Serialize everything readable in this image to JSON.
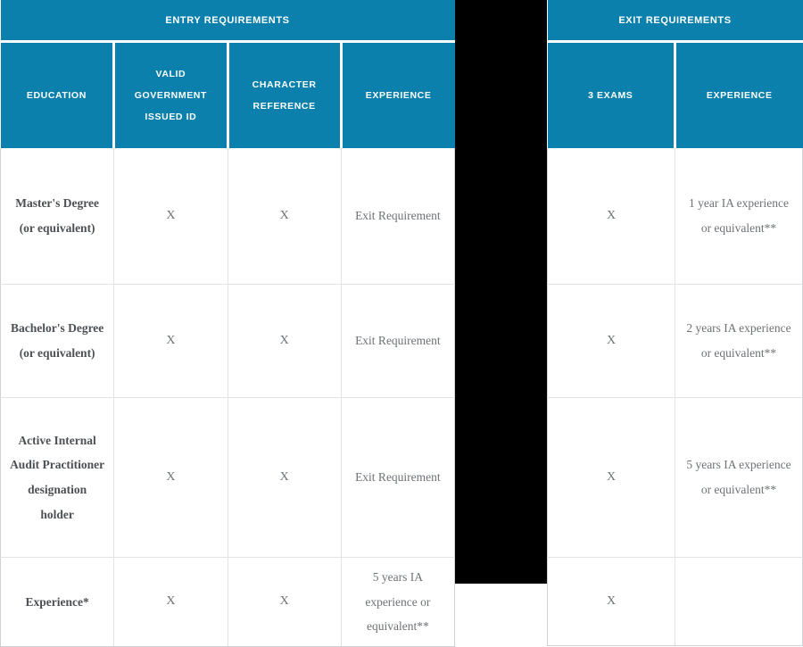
{
  "table": {
    "groups": [
      {
        "id": "entry",
        "label": "ENTRY REQUIREMENTS",
        "colspan": 4
      },
      {
        "id": "exit",
        "label": "EXIT REQUIREMENTS",
        "colspan": 2
      }
    ],
    "columns": {
      "entry": [
        {
          "id": "education",
          "label": "EDUCATION"
        },
        {
          "id": "valid_id",
          "label": "VALID\nGOVERNMENT\nISSUED ID"
        },
        {
          "id": "reference",
          "label": "CHARACTER\nREFERENCE"
        },
        {
          "id": "experience",
          "label": "EXPERIENCE"
        }
      ],
      "exit": [
        {
          "id": "exams",
          "label": "3 EXAMS"
        },
        {
          "id": "experience",
          "label": "EXPERIENCE"
        }
      ]
    },
    "rows": [
      {
        "education": "Master's Degree (or equivalent)",
        "valid_id": "X",
        "reference": "X",
        "entry_experience": "Exit Requirement",
        "exams": "X",
        "exit_experience": "1 year IA experience or equivalent**"
      },
      {
        "education": "Bachelor's Degree (or equivalent)",
        "valid_id": "X",
        "reference": "X",
        "entry_experience": "Exit Requirement",
        "exams": "X",
        "exit_experience": "2 years IA experience or equivalent**"
      },
      {
        "education": "Active Internal Audit Practitioner designation holder",
        "valid_id": "X",
        "reference": "X",
        "entry_experience": "Exit Requirement",
        "exams": "X",
        "exit_experience": "5 years IA experience or equivalent**"
      },
      {
        "education": "Experience*",
        "valid_id": "X",
        "reference": "X",
        "entry_experience": "5 years IA experience or equivalent**",
        "exams": "X",
        "exit_experience": ""
      }
    ]
  },
  "colors": {
    "header_background": "#0b80ac",
    "header_text": "#ffffff",
    "body_text": "#6d7276",
    "education_text": "#4c5054",
    "grid_line": "#e3e3e3",
    "occluder": "#000000",
    "page_background": "#ffffff"
  }
}
